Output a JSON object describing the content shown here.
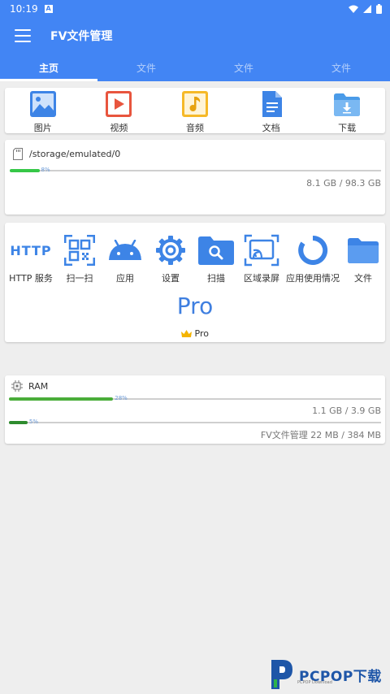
{
  "status_bar": {
    "time": "10:19",
    "notification_icon": "a-icon"
  },
  "app": {
    "title": "FV文件管理"
  },
  "tabs": [
    {
      "label": "主页",
      "active": true
    },
    {
      "label": "文件",
      "active": false
    },
    {
      "label": "文件",
      "active": false
    },
    {
      "label": "文件",
      "active": false
    }
  ],
  "categories": [
    {
      "label": "图片",
      "icon": "image-icon",
      "color": "#3d84e6"
    },
    {
      "label": "视频",
      "icon": "video-icon",
      "color": "#e8553e"
    },
    {
      "label": "音频",
      "icon": "audio-icon",
      "color": "#f6b928"
    },
    {
      "label": "文档",
      "icon": "document-icon",
      "color": "#3d84e6"
    },
    {
      "label": "下载",
      "icon": "download-icon",
      "color": "#4a9be8"
    }
  ],
  "storage": {
    "path": "/storage/emulated/0",
    "used_percent": 8,
    "used_percent_label": "8%",
    "size_text": "8.1 GB  /  98.3 GB",
    "bar_color": "#36c747"
  },
  "tools": [
    {
      "label": "HTTP 服务",
      "icon": "http-icon",
      "icon_text": "HTTP"
    },
    {
      "label": "扫一扫",
      "icon": "qr-scan-icon"
    },
    {
      "label": "应用",
      "icon": "android-icon"
    },
    {
      "label": "设置",
      "icon": "gear-icon"
    },
    {
      "label": "扫描",
      "icon": "folder-search-icon"
    },
    {
      "label": "区域录屏",
      "icon": "screen-cast-icon"
    },
    {
      "label": "应用使用情况",
      "icon": "usage-chart-icon"
    },
    {
      "label": "文件",
      "icon": "folder-icon"
    }
  ],
  "pro": {
    "big_label": "Pro",
    "small_label": "Pro",
    "crown_icon": "crown-icon"
  },
  "ram": {
    "title": "RAM",
    "used_percent": 28,
    "used_percent_label": "28%",
    "size_text": "1.1 GB / 3.9 GB",
    "bar_color": "#4aad3a",
    "app_used_percent": 5,
    "app_used_percent_label": "5%",
    "app_size_text": "FV文件管理  22 MB / 384 MB",
    "app_bar_color": "#2e8b2e"
  },
  "watermark": {
    "text": "PCPOP下载",
    "sub_text": "PCPOP Download"
  },
  "colors": {
    "primary": "#4285f4",
    "accent_text": "#3f7fe0"
  }
}
